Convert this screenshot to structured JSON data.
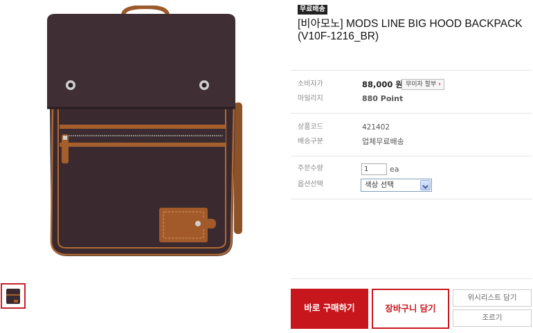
{
  "product": {
    "badge": "무료배송",
    "title": "[비아모노] MODS LINE BIG HOOD BACKPACK (V10F-1216_BR)"
  },
  "info": {
    "consumer_price_label": "소비자가",
    "consumer_price_value": "88,000 원",
    "installment_button": "무이자 할부",
    "mileage_label": "마일리지",
    "mileage_value": "880 Point",
    "product_code_label": "상품코드",
    "product_code_value": "421402",
    "shipping_label": "배송구분",
    "shipping_value": "업체무료배송",
    "quantity_label": "주문수량",
    "quantity_value": "1",
    "quantity_unit": "ea",
    "option_label": "옵션선택",
    "option_selected": "색상 선택"
  },
  "actions": {
    "buy_now": "바로 구매하기",
    "add_to_cart": "장바구니 담기",
    "wishlist": "위시리스트 담기",
    "beg": "조르기"
  },
  "colors": {
    "accent": "#c8161d",
    "bag_body": "#3b2a2f",
    "leather": "#a5602e"
  },
  "icons": {
    "installment_chevron": "chevron-right-icon",
    "select_arrow": "chevron-down-icon"
  }
}
